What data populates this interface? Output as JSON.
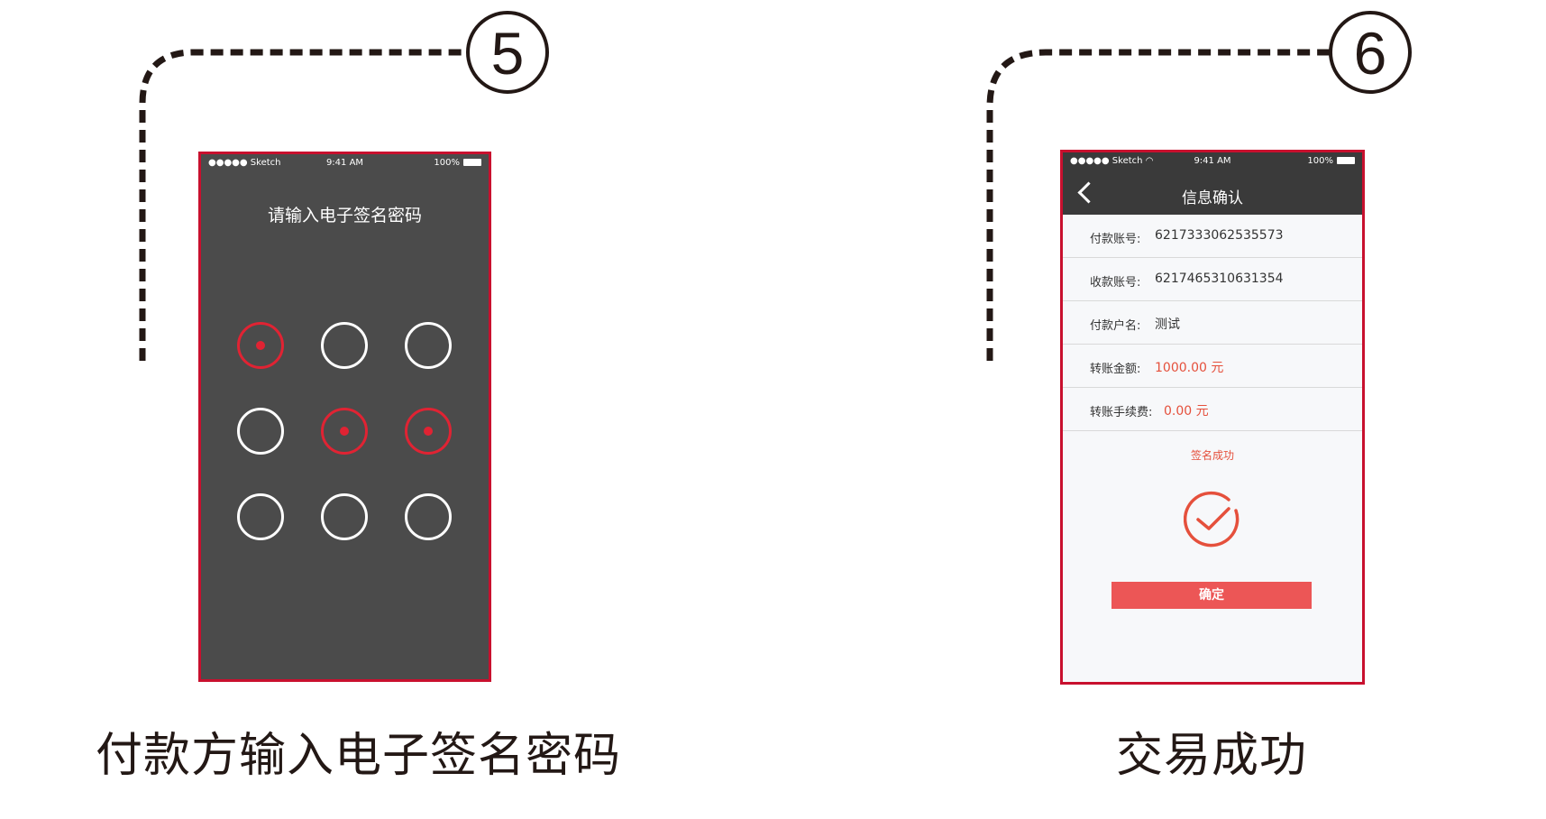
{
  "colors": {
    "accent": "#c8102e",
    "pattern_active": "#e02333",
    "success_red": "#e5503c",
    "button": "#ec5656"
  },
  "step5": {
    "number": "5",
    "caption": "付款方输入电子签名密码",
    "phone": {
      "status": {
        "carrier": "●●●●● Sketch",
        "time": "9:41 AM",
        "battery": "100%"
      },
      "title": "请输入电子签名密码",
      "pattern_active": [
        true,
        false,
        false,
        false,
        true,
        true,
        false,
        false,
        false
      ]
    }
  },
  "step6": {
    "number": "6",
    "caption": "交易成功",
    "phone": {
      "status": {
        "carrier": "●●●●● Sketch",
        "time": "9:41 AM",
        "battery": "100%"
      },
      "nav_title": "信息确认",
      "rows": [
        {
          "label": "付款账号:",
          "value": "6217333062535573"
        },
        {
          "label": "收款账号:",
          "value": "6217465310631354"
        },
        {
          "label": "付款户名:",
          "value": "测试"
        },
        {
          "label": "转账金额:",
          "value": "1000.00 元"
        },
        {
          "label": "转账手续费:",
          "value": "0.00 元"
        }
      ],
      "success_text": "签名成功",
      "confirm_label": "确定"
    }
  }
}
